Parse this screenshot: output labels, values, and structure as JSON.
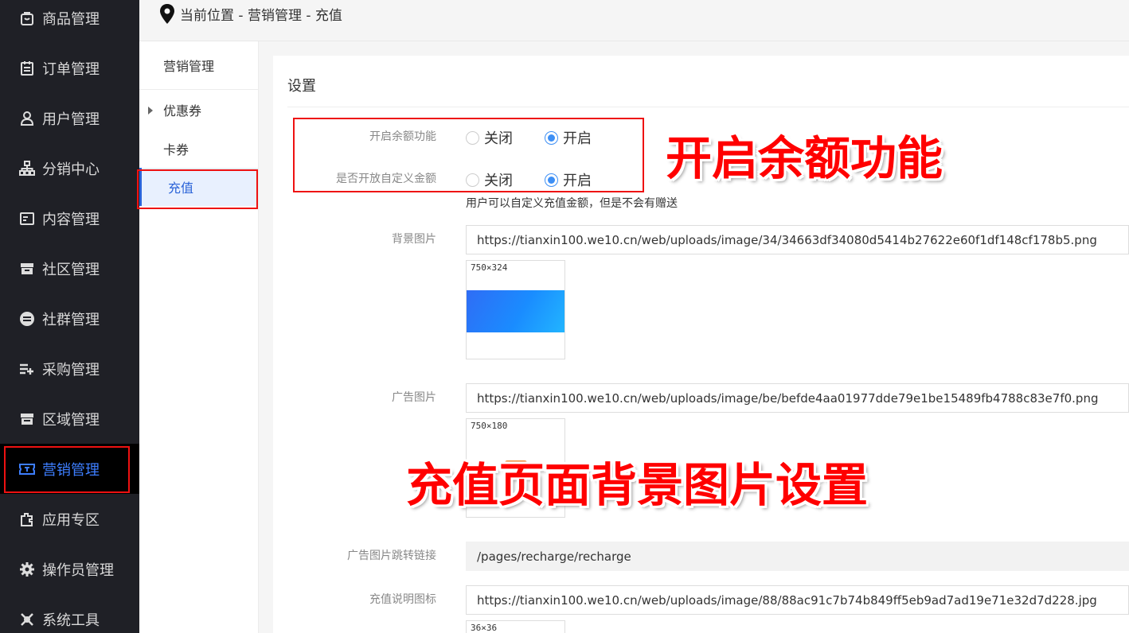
{
  "sidebar": {
    "items": [
      {
        "label": "商品管理",
        "icon": "bag-icon"
      },
      {
        "label": "订单管理",
        "icon": "clipboard-icon"
      },
      {
        "label": "用户管理",
        "icon": "user-icon"
      },
      {
        "label": "分销中心",
        "icon": "sitemap-icon"
      },
      {
        "label": "内容管理",
        "icon": "document-icon"
      },
      {
        "label": "社区管理",
        "icon": "store-icon"
      },
      {
        "label": "社群管理",
        "icon": "group-icon"
      },
      {
        "label": "采购管理",
        "icon": "list-add-icon"
      },
      {
        "label": "区域管理",
        "icon": "shop-icon"
      },
      {
        "label": "营销管理",
        "icon": "ticket-icon"
      },
      {
        "label": "应用专区",
        "icon": "puzzle-icon"
      },
      {
        "label": "操作员管理",
        "icon": "gear-icon"
      },
      {
        "label": "系统工具",
        "icon": "tools-icon"
      }
    ],
    "active_index": 9
  },
  "breadcrumb": {
    "text": "当前位置 - 营销管理 - 充值"
  },
  "submenu": {
    "title": "营销管理",
    "items": [
      {
        "label": "优惠券"
      },
      {
        "label": "卡券"
      },
      {
        "label": "充值"
      }
    ],
    "active_index": 2
  },
  "panel": {
    "title": "设置",
    "balance": {
      "label": "开启余额功能",
      "off": "关闭",
      "on": "开启",
      "selected": "开启"
    },
    "custom_amount": {
      "label": "是否开放自定义金额",
      "off": "关闭",
      "on": "开启",
      "selected": "开启",
      "hint": "用户可以自定义充值金额，但是不会有赠送"
    },
    "bg_image": {
      "label": "背景图片",
      "value": "https://tianxin100.we10.cn/web/uploads/image/34/34663df34080d5414b27622e60f1df148cf178b5.png",
      "size": "750×324"
    },
    "ad_image": {
      "label": "广告图片",
      "value": "https://tianxin100.we10.cn/web/uploads/image/be/befde4aa01977dde79e1be15489fb4788c83e7f0.png",
      "size": "750×180"
    },
    "ad_link": {
      "label": "广告图片跳转链接",
      "value": "/pages/recharge/recharge"
    },
    "explain_icon": {
      "label": "充值说明图标",
      "value": "https://tianxin100.we10.cn/web/uploads/image/88/88ac91c7b74b849ff5eb9ad7ad19e71e32d7d228.jpg",
      "size": "36×36"
    }
  },
  "annotations": {
    "balance": "开启余额功能",
    "background": "充值页面背景图片设置"
  },
  "colors": {
    "sidebar_bg": "#1f2026",
    "active_blue": "#3d7eff",
    "annotation_red": "#ff0000"
  }
}
